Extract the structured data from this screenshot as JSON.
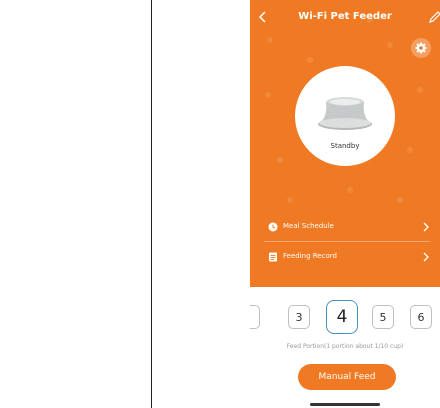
{
  "header": {
    "title": "Wi-Fi Pet Feeder"
  },
  "device": {
    "status": "Standby"
  },
  "menu": [
    {
      "label": "Meal Schedule",
      "icon": "clock-icon"
    },
    {
      "label": "Feeding Record",
      "icon": "record-icon"
    }
  ],
  "portion": {
    "options": [
      "3",
      "4",
      "5",
      "6"
    ],
    "selected": "4",
    "caption": "Feed Portion(1 portion about 1/10 cup)"
  },
  "actions": {
    "manual_feed_label": "Manual Feed"
  },
  "colors": {
    "accent": "#f07a23",
    "selected_border": "#4a90b8"
  }
}
